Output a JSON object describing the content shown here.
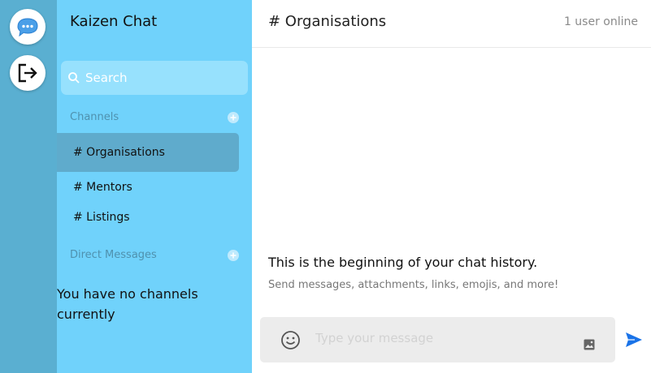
{
  "rail": {
    "buttons": [
      {
        "icon": "chat-bubble-icon"
      },
      {
        "icon": "logout-icon"
      }
    ]
  },
  "sidebar": {
    "workspace_name": "Kaizen Chat",
    "search_placeholder": "Search",
    "channels_label": "Channels",
    "channels": [
      {
        "label": "# Organisations",
        "active": true
      },
      {
        "label": "# Mentors",
        "active": false
      },
      {
        "label": "# Listings",
        "active": false
      }
    ],
    "dms_label": "Direct Messages",
    "empty_text": "You have no channels currently"
  },
  "main": {
    "room_title": "# Organisations",
    "online_status": "1 user online",
    "history_title": "This is the beginning of your chat history.",
    "history_subtitle": "Send messages, attachments, links, emojis, and more!",
    "composer_placeholder": "Type your message"
  },
  "colors": {
    "rail": "#5aafd1",
    "sidebar": "#70d2fb",
    "active_channel": "#5fabcc",
    "send": "#1a73e8"
  }
}
